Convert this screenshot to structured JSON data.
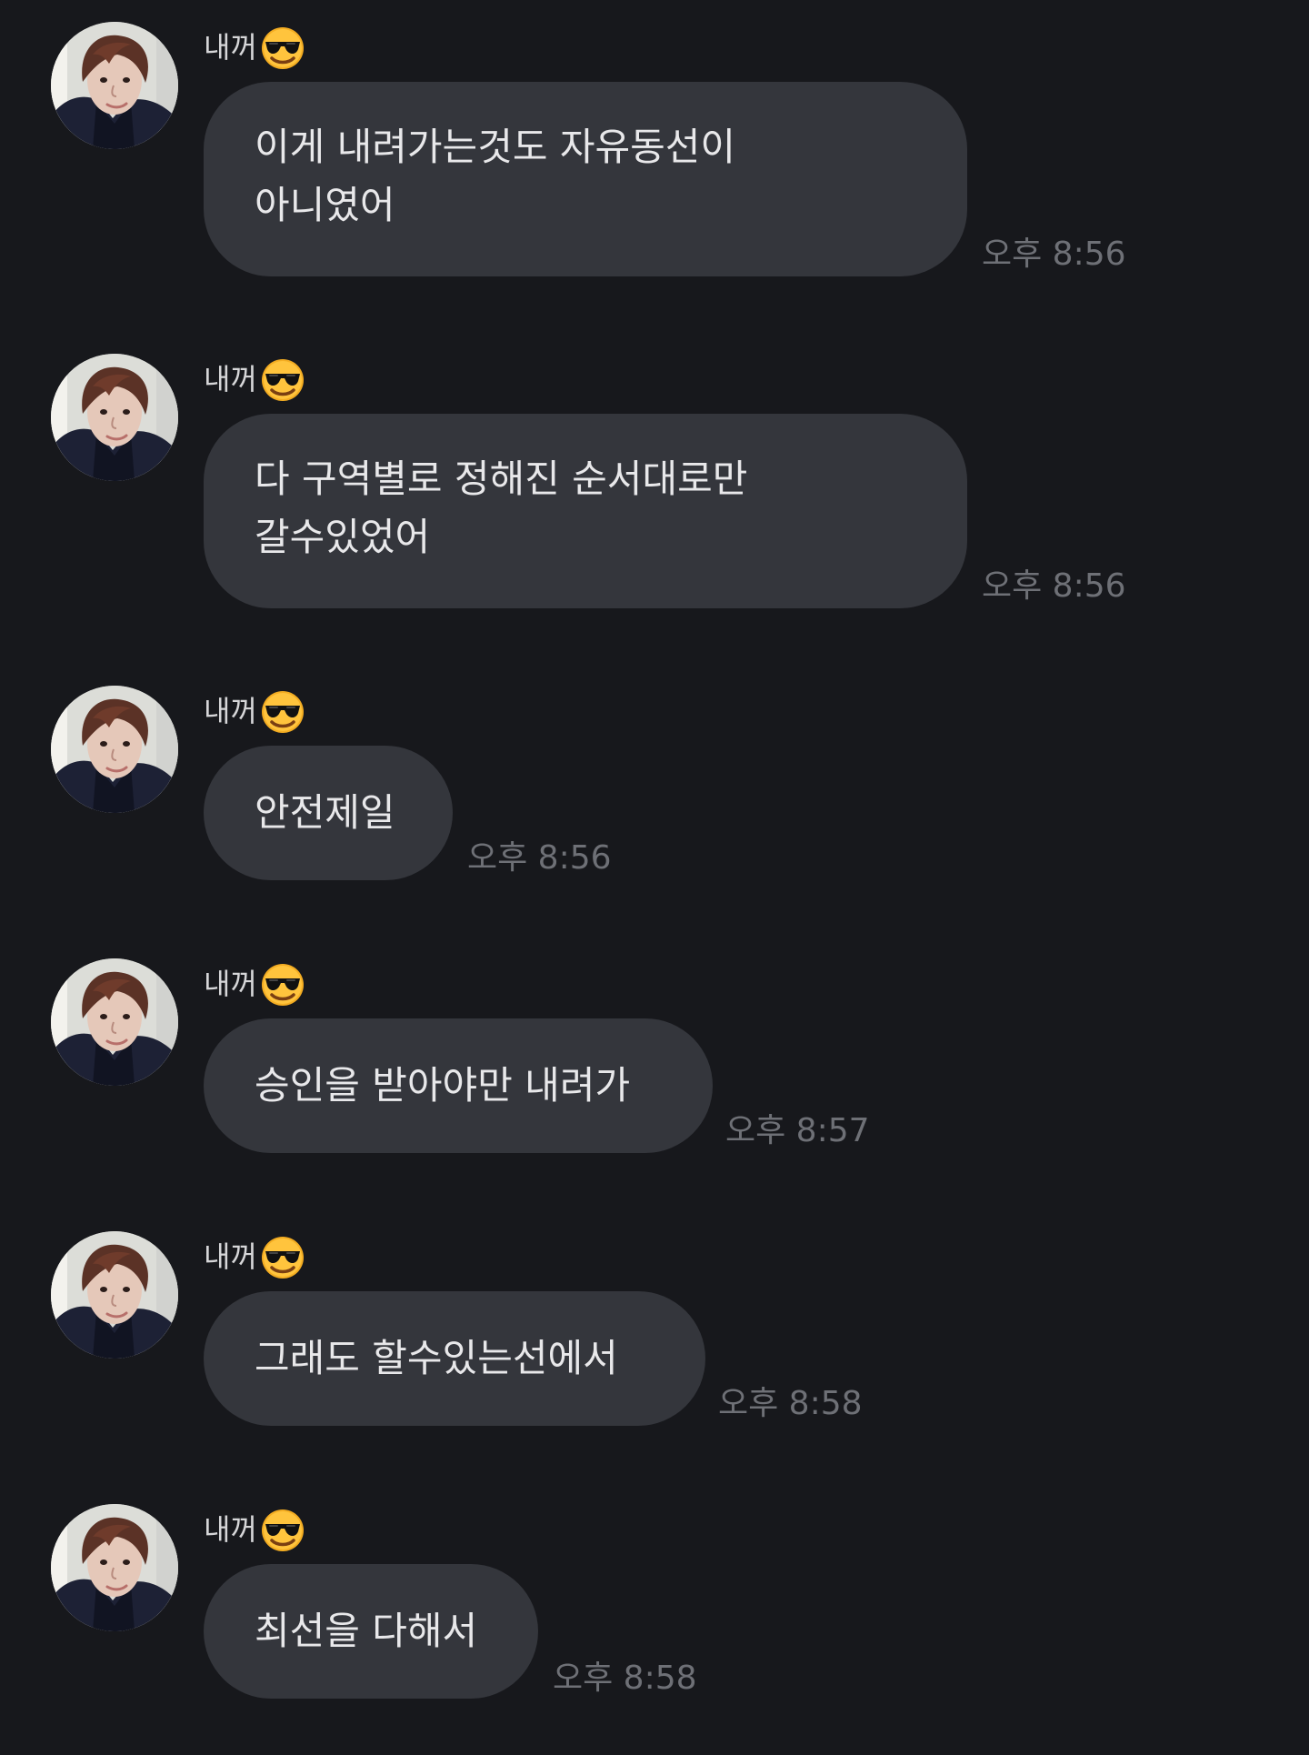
{
  "messages": [
    {
      "sender": "내꺼",
      "text": "이게 내려가는것도 자유동선이\n아니였어",
      "time": "오후 8:56"
    },
    {
      "sender": "내꺼",
      "text": "다 구역별로 정해진 순서대로만\n갈수있었어",
      "time": "오후 8:56"
    },
    {
      "sender": "내꺼",
      "text": "안전제일",
      "time": "오후 8:56"
    },
    {
      "sender": "내꺼",
      "text": "승인을 받아야만 내려가",
      "time": "오후 8:57"
    },
    {
      "sender": "내꺼",
      "text": "그래도 할수있는선에서",
      "time": "오후 8:58"
    },
    {
      "sender": "내꺼",
      "text": "최선을 다해서",
      "time": "오후 8:58"
    }
  ],
  "icons": {
    "sender_emoji": "sunglasses-smiling-face-icon",
    "avatar": "profile-photo"
  },
  "colors": {
    "background": "#17181c",
    "bubble": "#34363c",
    "text": "#e8e8ea",
    "time": "#6e7076"
  }
}
